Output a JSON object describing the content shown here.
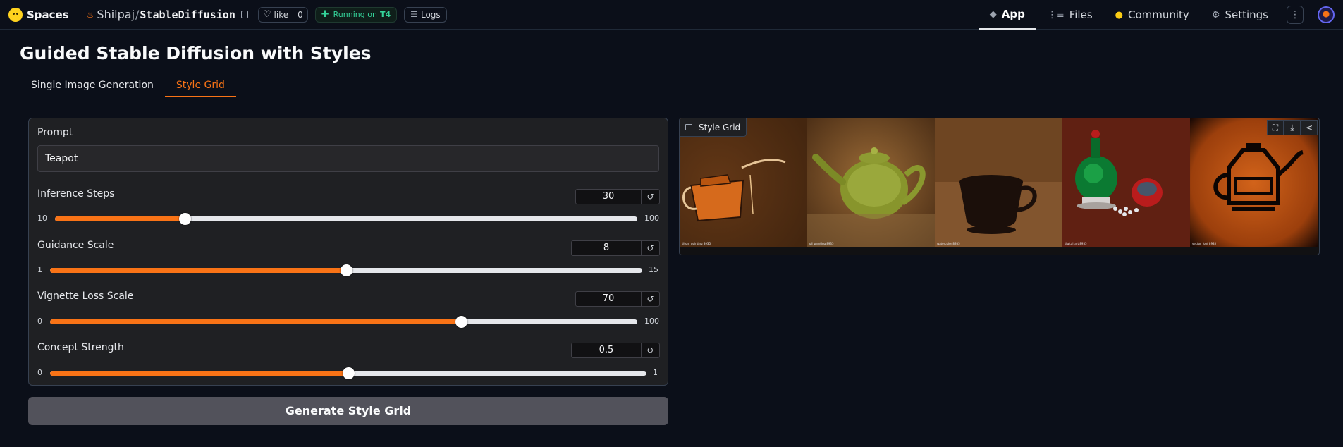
{
  "nav": {
    "brand": "Spaces",
    "repo_owner": "Shilpaj",
    "repo_slash": "/",
    "repo_name": "StableDiffusion",
    "like_label": "like",
    "like_count": "0",
    "running_label": "Running on",
    "running_hw": "T4",
    "logs_label": "Logs",
    "tabs": [
      {
        "label": "App",
        "icon": "app-icon",
        "active": true
      },
      {
        "label": "Files",
        "icon": "files-icon",
        "active": false
      },
      {
        "label": "Community",
        "icon": "community-icon",
        "active": false
      },
      {
        "label": "Settings",
        "icon": "gear-icon",
        "active": false
      }
    ]
  },
  "page": {
    "title": "Guided Stable Diffusion with Styles",
    "tabs": [
      {
        "label": "Single Image Generation",
        "active": false
      },
      {
        "label": "Style Grid",
        "active": true
      }
    ]
  },
  "form": {
    "prompt_label": "Prompt",
    "prompt_value": "Teapot",
    "sliders": [
      {
        "label": "Inference Steps",
        "value": "30",
        "min": "10",
        "max": "100",
        "fraction": 0.2222
      },
      {
        "label": "Guidance Scale",
        "value": "8",
        "min": "1",
        "max": "15",
        "fraction": 0.5
      },
      {
        "label": "Vignette Loss Scale",
        "value": "70",
        "min": "0",
        "max": "100",
        "fraction": 0.7
      },
      {
        "label": "Concept Strength",
        "value": "0.5",
        "min": "0",
        "max": "1",
        "fraction": 0.5
      }
    ],
    "reset_glyph": "↺",
    "generate_label": "Generate Style Grid"
  },
  "gallery": {
    "label": "Style Grid",
    "tools": [
      "fullscreen-icon",
      "download-icon",
      "share-icon"
    ],
    "images": [
      {
        "name": "style-image-1",
        "caption": "dhoni_painting 8935"
      },
      {
        "name": "style-image-2",
        "caption": "oil_painting 8935"
      },
      {
        "name": "style-image-3",
        "caption": "watercolor 8935"
      },
      {
        "name": "style-image-4",
        "caption": "digital_art 8935"
      },
      {
        "name": "style-image-5",
        "caption": "vector_font 8935"
      }
    ]
  },
  "colors": {
    "accent": "#f97316",
    "background": "#0b0f19",
    "panel": "#1f2023",
    "running_green": "#34d399"
  }
}
